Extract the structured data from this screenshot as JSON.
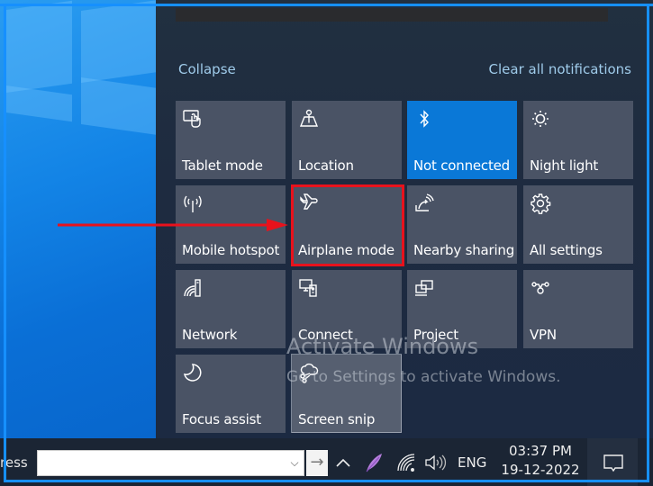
{
  "action_center": {
    "collapse_label": "Collapse",
    "clear_all_label": "Clear all notifications",
    "tiles": [
      {
        "label": "Tablet mode",
        "icon": "tablet-mode-icon",
        "active": false
      },
      {
        "label": "Location",
        "icon": "location-icon",
        "active": false
      },
      {
        "label": "Not connected",
        "icon": "bluetooth-icon",
        "active": true
      },
      {
        "label": "Night light",
        "icon": "night-light-icon",
        "active": false
      },
      {
        "label": "Mobile hotspot",
        "icon": "mobile-hotspot-icon",
        "active": false
      },
      {
        "label": "Airplane mode",
        "icon": "airplane-icon",
        "active": false,
        "highlighted": true
      },
      {
        "label": "Nearby sharing",
        "icon": "nearby-sharing-icon",
        "active": false
      },
      {
        "label": "All settings",
        "icon": "gear-icon",
        "active": false
      },
      {
        "label": "Network",
        "icon": "network-icon",
        "active": false
      },
      {
        "label": "Connect",
        "icon": "connect-icon",
        "active": false
      },
      {
        "label": "Project",
        "icon": "project-icon",
        "active": false
      },
      {
        "label": "VPN",
        "icon": "vpn-icon",
        "active": false
      },
      {
        "label": "Focus assist",
        "icon": "moon-icon",
        "active": false
      },
      {
        "label": "Screen snip",
        "icon": "screen-snip-icon",
        "active": false
      }
    ]
  },
  "watermark": {
    "title": "Activate Windows",
    "subtitle": "Go to Settings to activate Windows."
  },
  "taskbar": {
    "address_label": "ress",
    "address_value": "",
    "go_arrow": "→",
    "dropdown_glyph": "⌵",
    "language": "ENG",
    "time": "03:37 PM",
    "date": "19-12-2022"
  },
  "colors": {
    "tile_bg": "#4a5365",
    "tile_active": "#0a78d7",
    "highlight_red": "#e8121c",
    "link": "#9fcbea",
    "frame_blue": "#1690ff"
  }
}
